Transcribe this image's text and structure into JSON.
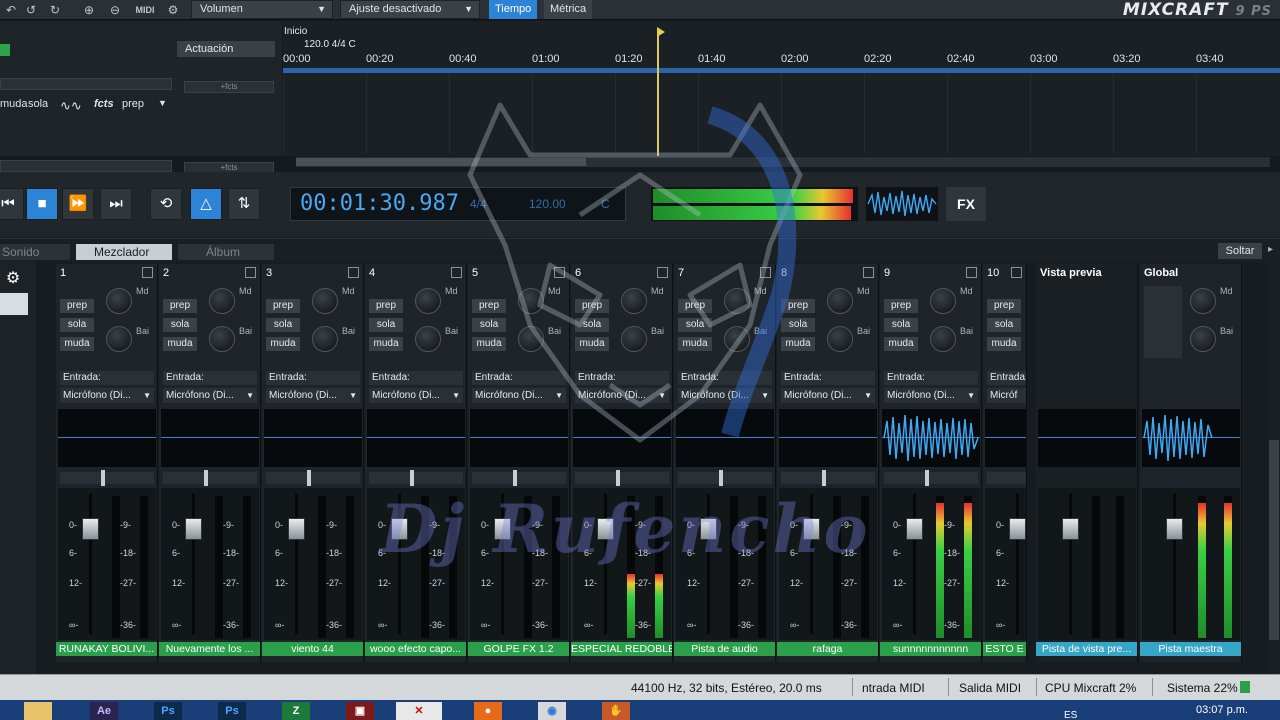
{
  "toolbar": {
    "volume_select": "Volumen",
    "snap_select": "Ajuste desactivado",
    "tab_time": "Tiempo",
    "tab_metric": "Métrica",
    "midi_label": "MIDI",
    "brand": "MIXCRAFT",
    "brand_sub": "9 PS"
  },
  "tracks": {
    "actuacion": "Actuación",
    "fcts_box": "+fcts",
    "btn_muda": "muda",
    "btn_sola": "sola",
    "btn_fcts": "fcts",
    "btn_prep": "prep"
  },
  "timeline": {
    "marker_name": "Inicio",
    "marker_info": "120.0 4/4 C",
    "ticks": [
      "00:00",
      "00:20",
      "00:40",
      "01:00",
      "01:20",
      "01:40",
      "02:00",
      "02:20",
      "02:40",
      "03:00",
      "03:20",
      "03:40"
    ]
  },
  "transport": {
    "time": "00:01:30.987",
    "signature": "4/4",
    "bpm": "120.00",
    "key": "C",
    "fx_label": "FX"
  },
  "tabs": {
    "sonido": "Sonido",
    "mezclador": "Mezclador",
    "album": "Álbum",
    "soltar": "Soltar"
  },
  "mixer": {
    "entrada_label": "Entrada:",
    "knob_md": "Md",
    "knob_bai": "Bai",
    "scale_left": [
      "0-",
      "6-",
      "12-",
      "∞-"
    ],
    "scale_right": [
      "-9-",
      "-18-",
      "-27-",
      "-36-"
    ],
    "channels": [
      {
        "num": "1",
        "name": "RUNAKAY BOLIVI...",
        "input": "Micrófono (Di...",
        "level": 0,
        "wave": false
      },
      {
        "num": "2",
        "name": "Nuevamente los ...",
        "input": "Micrófono (Di...",
        "level": 0,
        "wave": false
      },
      {
        "num": "3",
        "name": "viento 44",
        "input": "Micrófono (Di...",
        "level": 0,
        "wave": false
      },
      {
        "num": "4",
        "name": "wooo efecto capo...",
        "input": "Micrófono (Di...",
        "level": 0,
        "wave": false
      },
      {
        "num": "5",
        "name": "GOLPE FX 1.2",
        "input": "Micrófono (Di...",
        "level": 0,
        "wave": false
      },
      {
        "num": "6",
        "name": "ESPECIAL REDOBLE",
        "input": "Micrófono (Di...",
        "level": 0.45,
        "wave": false
      },
      {
        "num": "7",
        "name": "Pista de audio",
        "input": "Micrófono (Di...",
        "level": 0,
        "wave": false
      },
      {
        "num": "8",
        "name": "rafaga",
        "input": "Micrófono (Di...",
        "level": 0,
        "wave": false
      },
      {
        "num": "9",
        "name": "sunnnnnnnnnnn",
        "input": "Micrófono (Di...",
        "level": 0.95,
        "wave": true
      },
      {
        "num": "10",
        "name": "ESTO E",
        "input": "Micróf",
        "level": 0,
        "wave": false
      }
    ],
    "preview_title": "Vista previa",
    "preview_name": "Pista de vista pre...",
    "global_title": "Global",
    "global_name": "Pista maestra"
  },
  "status": {
    "audio_format": "44100 Hz, 32 bits, Estéreo, 20.0 ms",
    "midi_in": "ntrada MIDI",
    "midi_out": "Salida MIDI",
    "cpu": "CPU Mixcraft 2%",
    "system": "Sistema 22%"
  },
  "taskbar": {
    "lang": "ES",
    "clock": "03:07 p.m."
  },
  "watermark": {
    "text": "Dj Rufencho"
  }
}
